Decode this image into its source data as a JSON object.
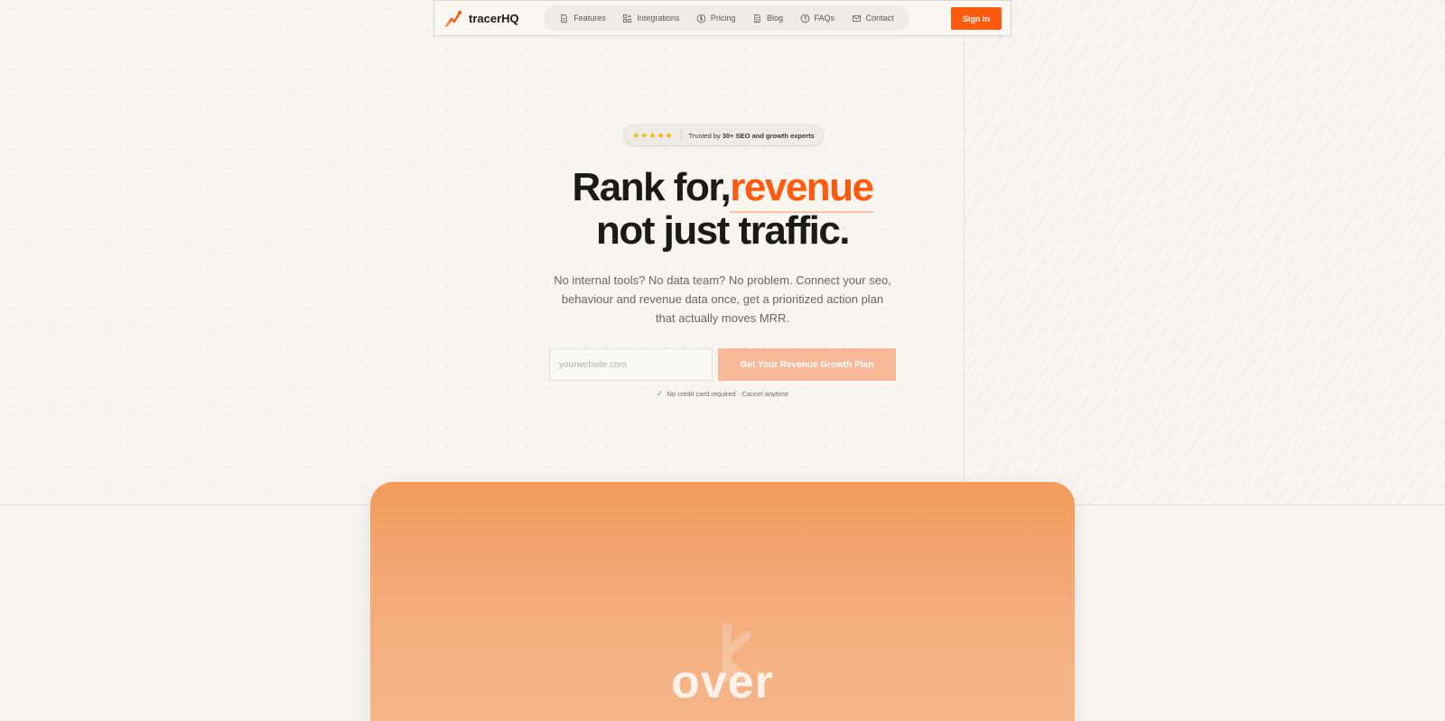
{
  "brand": {
    "name": "tracerHQ",
    "accent": "#ff5a0e"
  },
  "nav": {
    "items": [
      {
        "label": "Features",
        "icon": "document-icon"
      },
      {
        "label": "Integrations",
        "icon": "grid-plus-icon"
      },
      {
        "label": "Pricing",
        "icon": "dollar-circle-icon"
      },
      {
        "label": "Blog",
        "icon": "page-icon"
      },
      {
        "label": "FAQs",
        "icon": "help-circle-icon"
      },
      {
        "label": "Contact",
        "icon": "mail-icon"
      }
    ],
    "signin_label": "Sign in"
  },
  "badge": {
    "stars": "★★★★★",
    "prefix": "Trusted by ",
    "strong": "30+ SEO and growth experts"
  },
  "hero": {
    "line1_before": "Rank for,",
    "line1_accent": "revenue",
    "line2": "not just traffic.",
    "subhead": "No internal tools? No data team? No problem. Connect your seo, behaviour and revenue data once, get a prioritized action plan that actually moves MRR."
  },
  "form": {
    "placeholder": "yourwebsite.com",
    "cta_label": "Get Your Revenue Growth Plan",
    "note_check": "✓",
    "note": "No credit card required · Cancel anytime"
  },
  "card": {
    "word": "over",
    "colors": {
      "top": "#f29b5c",
      "bottom": "#f6b98e"
    }
  }
}
